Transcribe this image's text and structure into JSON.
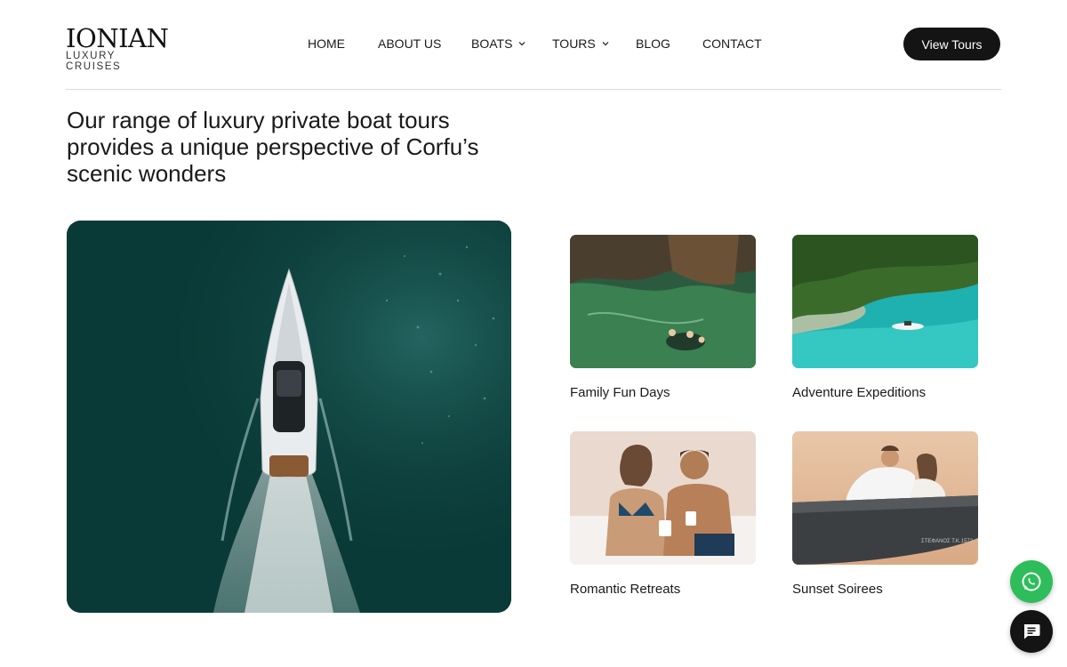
{
  "brand": {
    "name": "IONIAN",
    "tagline": "LUXURY CRUISES"
  },
  "nav": {
    "items": [
      {
        "label": "HOME",
        "has_dropdown": false
      },
      {
        "label": "ABOUT US",
        "has_dropdown": false
      },
      {
        "label": "BOATS",
        "has_dropdown": true
      },
      {
        "label": "TOURS",
        "has_dropdown": true
      },
      {
        "label": "BLOG",
        "has_dropdown": false
      },
      {
        "label": "CONTACT",
        "has_dropdown": false
      }
    ],
    "dropdown_icon": "chevron-down-icon"
  },
  "header": {
    "cta_label": "View Tours"
  },
  "main": {
    "headline": "Our range of luxury private boat tours provides a unique perspective of Corfu’s scenic wonders",
    "hero_image": "speedboat-aerial-image",
    "cards": [
      {
        "title": "Family Fun Days",
        "image": "family-swimming-image"
      },
      {
        "title": "Adventure Expeditions",
        "image": "turquoise-cove-image"
      },
      {
        "title": "Romantic Retreats",
        "image": "couple-toasting-image"
      },
      {
        "title": "Sunset Soirees",
        "image": "couple-on-boat-image"
      }
    ]
  },
  "floating": {
    "whatsapp_icon": "whatsapp-icon",
    "chat_icon": "chat-bubble-icon"
  },
  "colors": {
    "accent_dark": "#141414",
    "whatsapp_green": "#2ebd5a",
    "sea_teal": "#0b3d3a",
    "divider": "#dcdcdc"
  }
}
